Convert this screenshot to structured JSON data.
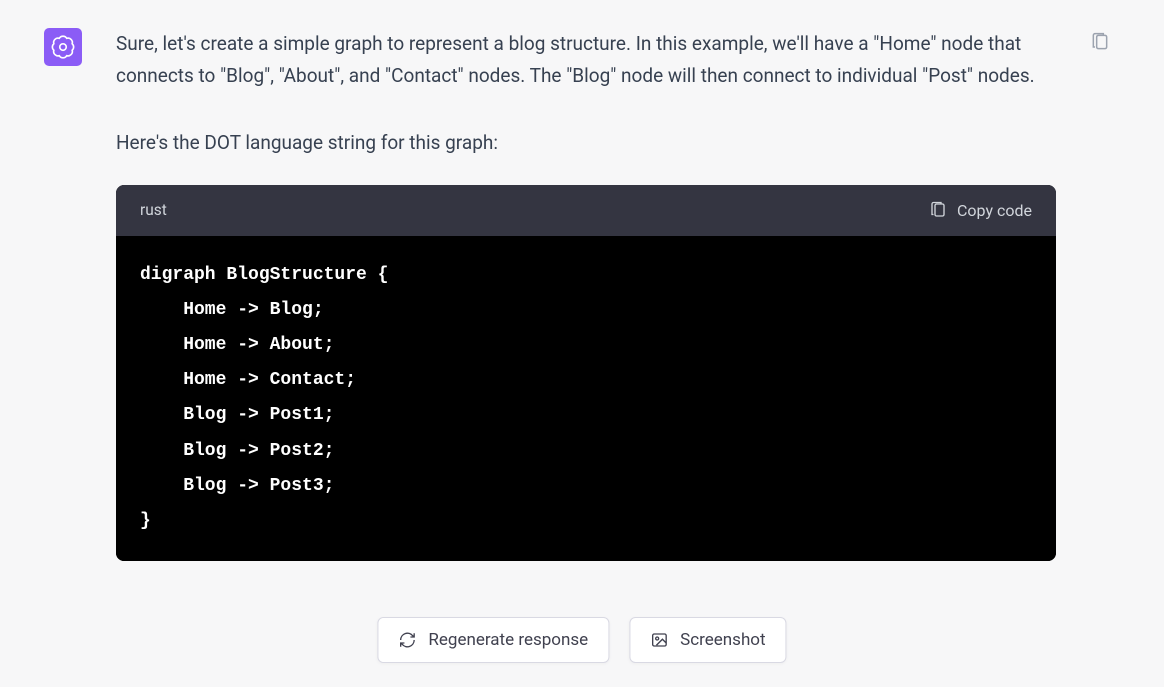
{
  "message": {
    "paragraph1": "Sure, let's create a simple graph to represent a blog structure. In this example, we'll have a \"Home\" node that connects to \"Blog\", \"About\", and \"Contact\" nodes. The \"Blog\" node will then connect to individual \"Post\" nodes.",
    "paragraph2": "Here's the DOT language string for this graph:"
  },
  "code": {
    "language": "rust",
    "copy_label": "Copy code",
    "content": "digraph BlogStructure {\n    Home -> Blog;\n    Home -> About;\n    Home -> Contact;\n    Blog -> Post1;\n    Blog -> Post2;\n    Blog -> Post3;\n}"
  },
  "buttons": {
    "regenerate": "Regenerate response",
    "screenshot": "Screenshot"
  }
}
